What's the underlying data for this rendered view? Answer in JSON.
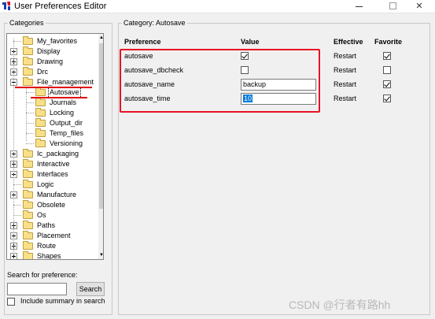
{
  "window": {
    "title": "User Preferences Editor",
    "minimize_label": "—",
    "maximize_label": "",
    "close_label": "✕"
  },
  "categories": {
    "legend": "Categories",
    "search_label": "Search for preference:",
    "search_value": "",
    "search_button": "Search",
    "include_summary_label": "Include summary in search",
    "include_summary_checked": false,
    "tree": [
      {
        "label": "My_favorites",
        "expander": "none",
        "level": 0
      },
      {
        "label": "Display",
        "expander": "plus",
        "level": 0
      },
      {
        "label": "Drawing",
        "expander": "plus",
        "level": 0
      },
      {
        "label": "Drc",
        "expander": "plus",
        "level": 0
      },
      {
        "label": "File_management",
        "expander": "minus",
        "level": 0
      },
      {
        "label": "Autosave",
        "expander": "none",
        "level": 1,
        "selected": true
      },
      {
        "label": "Journals",
        "expander": "none",
        "level": 1
      },
      {
        "label": "Locking",
        "expander": "none",
        "level": 1
      },
      {
        "label": "Output_dir",
        "expander": "none",
        "level": 1
      },
      {
        "label": "Temp_files",
        "expander": "none",
        "level": 1
      },
      {
        "label": "Versioning",
        "expander": "none",
        "level": 1
      },
      {
        "label": "Ic_packaging",
        "expander": "plus",
        "level": 0
      },
      {
        "label": "Interactive",
        "expander": "plus",
        "level": 0
      },
      {
        "label": "Interfaces",
        "expander": "plus",
        "level": 0
      },
      {
        "label": "Logic",
        "expander": "none",
        "level": 0
      },
      {
        "label": "Manufacture",
        "expander": "plus",
        "level": 0
      },
      {
        "label": "Obsolete",
        "expander": "none",
        "level": 0
      },
      {
        "label": "Os",
        "expander": "none",
        "level": 0
      },
      {
        "label": "Paths",
        "expander": "plus",
        "level": 0
      },
      {
        "label": "Placement",
        "expander": "plus",
        "level": 0
      },
      {
        "label": "Route",
        "expander": "plus",
        "level": 0
      },
      {
        "label": "Shapes",
        "expander": "plus",
        "level": 0
      }
    ]
  },
  "category_panel": {
    "legend": "Category:  Autosave",
    "headers": {
      "preference": "Preference",
      "value": "Value",
      "effective": "Effective",
      "favorite": "Favorite"
    },
    "rows": [
      {
        "name": "autosave",
        "value_type": "checkbox",
        "checked": true,
        "effective": "Restart",
        "favorite": true
      },
      {
        "name": "autosave_dbcheck",
        "value_type": "checkbox",
        "checked": false,
        "effective": "Restart",
        "favorite": false
      },
      {
        "name": "autosave_name",
        "value_type": "text",
        "value": "backup",
        "effective": "Restart",
        "favorite": true
      },
      {
        "name": "autosave_time",
        "value_type": "text",
        "value": "10",
        "selected": true,
        "effective": "Restart",
        "favorite": true
      }
    ]
  },
  "watermark": "CSDN @行者有路hh",
  "colors": {
    "highlight_red": "#e81123",
    "selection_blue": "#0078d7",
    "folder_yellow": "#f8e088"
  }
}
